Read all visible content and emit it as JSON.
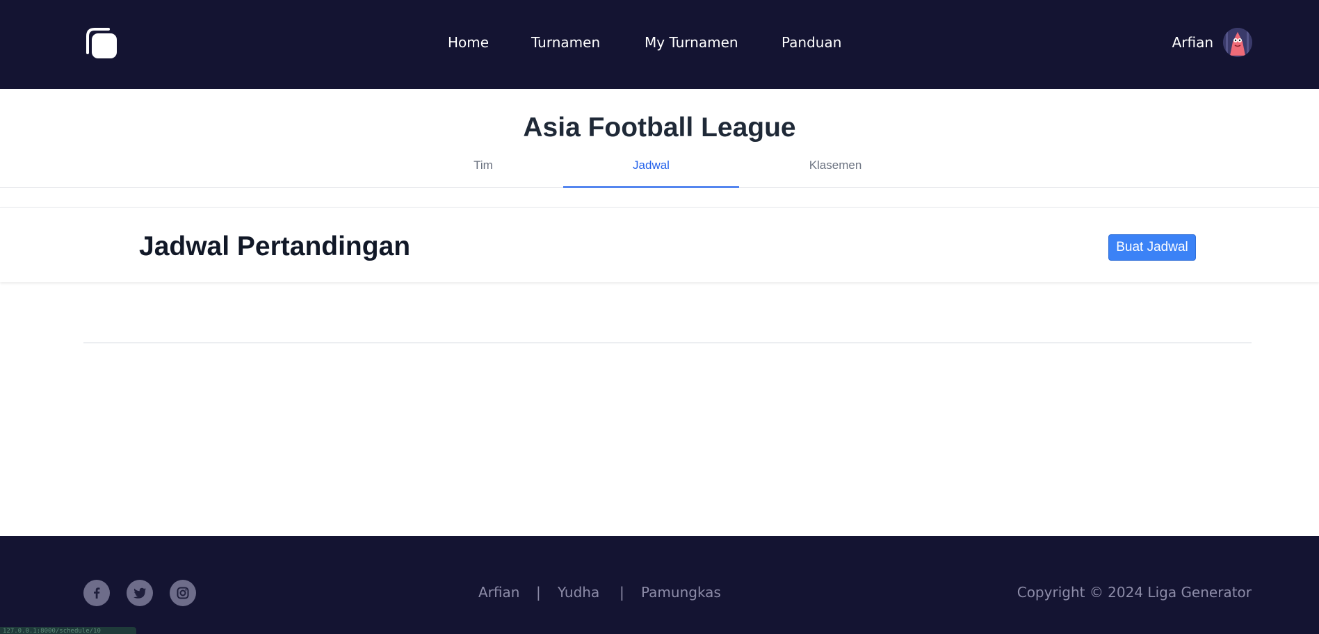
{
  "navbar": {
    "logo_icon": "rounded-square-logo-icon",
    "links": [
      {
        "label": "Home"
      },
      {
        "label": "Turnamen"
      },
      {
        "label": "My Turnamen"
      },
      {
        "label": "Panduan"
      }
    ],
    "user_name": "Arfian",
    "avatar_icon": "user-avatar"
  },
  "tournament": {
    "title": "Asia Football League",
    "tabs": [
      {
        "label": "Tim",
        "active": false
      },
      {
        "label": "Jadwal",
        "active": true
      },
      {
        "label": "Klasemen",
        "active": false
      }
    ]
  },
  "schedule": {
    "heading": "Jadwal Pertandingan",
    "create_button": "Buat Jadwal"
  },
  "footer": {
    "social_icons": [
      "facebook-icon",
      "twitter-icon",
      "instagram-icon"
    ],
    "links": [
      {
        "label": "Arfian"
      },
      {
        "label": "Yudha"
      },
      {
        "label": "Pamungkas"
      }
    ],
    "separator": "|",
    "copyright": "Copyright © 2024 Liga Generator",
    "status_text": "127.0.0.1:8000/schedule/10"
  },
  "colors": {
    "navbar_bg": "#141432",
    "accent": "#3b82f6",
    "active_tab": "#2563eb",
    "footer_text": "#8d8ca8"
  }
}
